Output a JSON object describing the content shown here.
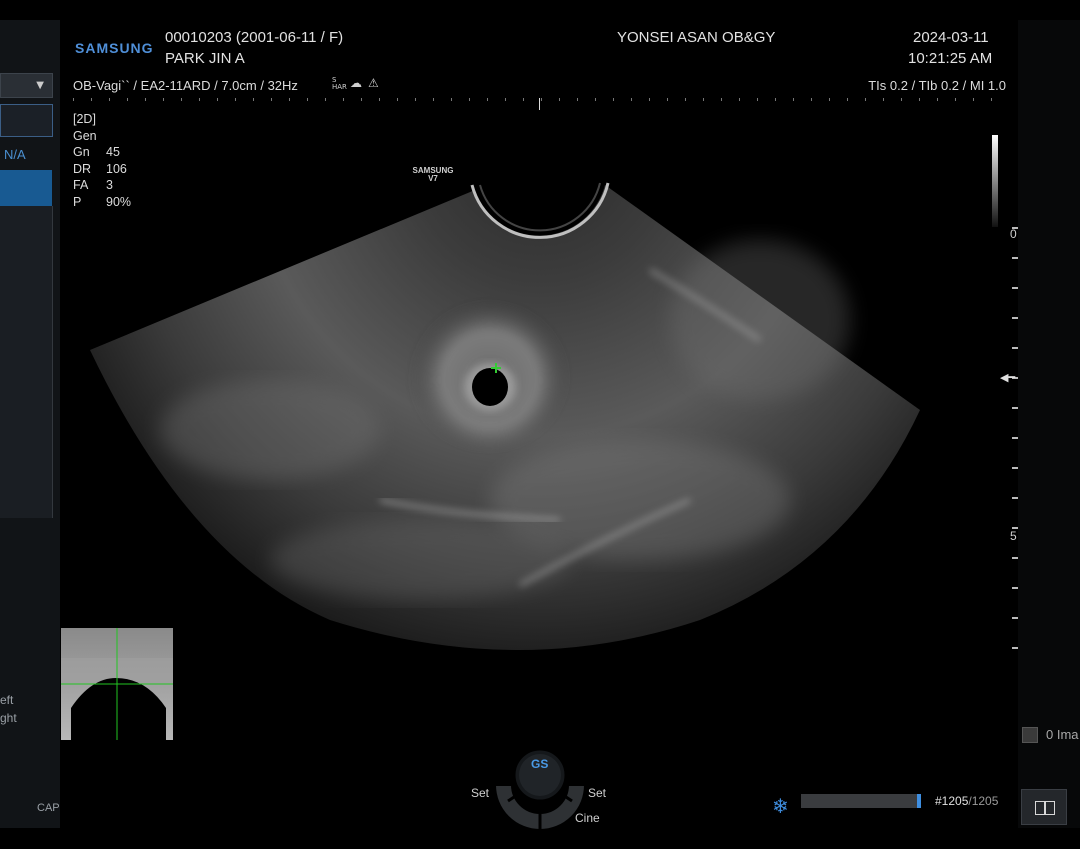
{
  "header": {
    "logo": "SAMSUNG",
    "patient_id": "00010203 (2001-06-11 / F)",
    "patient_name": "PARK JIN A",
    "institution": "YONSEI ASAN OB&GY",
    "date": "2024-03-11",
    "time": "10:21:25 AM",
    "mode_line": "OB-Vagi`` / EA2-11ARD / 7.0cm / 32Hz",
    "har_label": "S HAR",
    "indices": "TIs  0.2 / TIb  0.2 / MI    1.0"
  },
  "params": {
    "mode": "[2D]",
    "preset": "Gen",
    "rows": [
      {
        "key": "Gn",
        "value": "45"
      },
      {
        "key": "DR",
        "value": "106"
      },
      {
        "key": "FA",
        "value": "3"
      },
      {
        "key": "P",
        "value": "90%"
      }
    ]
  },
  "probe_label": {
    "brand": "SAMSUNG",
    "model": "V7"
  },
  "left_panel": {
    "dropdown_arrow": "▼",
    "na_label": "N/A",
    "text_left": "eft",
    "text_right": "ght",
    "cap": "CAP"
  },
  "depth_scale": {
    "label_top": "0",
    "label_mid": "5"
  },
  "right_panel": {
    "image_count": "0 Ima"
  },
  "controls": {
    "knob_label": "GS",
    "set_left": "Set",
    "set_right": "Set",
    "cine": "Cine",
    "freeze_icon": "snowflake-icon",
    "frame_current": "#1205",
    "frame_total": "/1205",
    "cine_progress": 1.0
  },
  "colors": {
    "accent_blue": "#4f8fd8",
    "cursor_green": "#33cc33"
  }
}
